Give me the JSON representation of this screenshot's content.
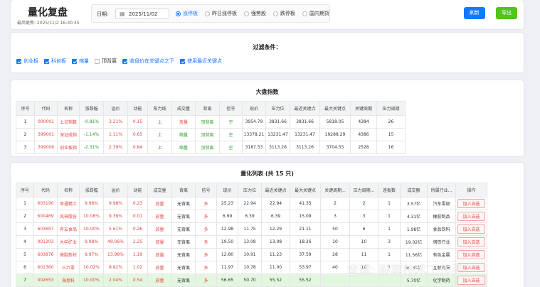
{
  "header": {
    "title": "量化复盘",
    "last_update": "最后更新: 2025/11/2 16:30:35",
    "date_label": "日期:",
    "date_value": "2025/11/02",
    "radio_options": [
      "涨停板",
      "昨日涨停板",
      "强势股",
      "跌停板",
      "国内期货"
    ],
    "selected_option": "涨停板",
    "refresh_label": "刷新",
    "export_label": "导出"
  },
  "filters": {
    "title": "过滤条件：",
    "items": [
      {
        "label": "创业板",
        "checked": true
      },
      {
        "label": "科创板",
        "checked": true
      },
      {
        "label": "缩量",
        "checked": true
      },
      {
        "label": "顶背离",
        "checked": false
      },
      {
        "label": "收盘价在关键点之下",
        "checked": true
      },
      {
        "label": "使用最近关键点",
        "checked": true
      }
    ]
  },
  "market": {
    "title": "大盘指数",
    "columns": [
      "序号",
      "代码",
      "名称",
      "涨跌幅",
      "溢价",
      "动能",
      "阳力线",
      "成交量",
      "背离",
      "信号",
      "现价",
      "压力位",
      "最近关键点",
      "最大关键点",
      "关键周期",
      "压力周期"
    ],
    "rows": [
      [
        "1",
        "000001",
        "上证指数",
        "-0.81%",
        "3.21%",
        "0.15",
        "上",
        "放量",
        "顶背离",
        "空",
        "3954.79",
        "3831.66",
        "3831.66",
        "5818.05",
        "4384",
        "26"
      ],
      [
        "2",
        "399001",
        "深证成指",
        "-1.14%",
        "1.11%",
        "0.65",
        "上",
        "缩量",
        "顶背离",
        "空",
        "13378.21",
        "13231.47",
        "13231.47",
        "19288.29",
        "4386",
        "15"
      ],
      [
        "3",
        "399006",
        "创业板指",
        "-2.31%",
        "2.39%",
        "0.84",
        "上",
        "缩量",
        "顶背离",
        "空",
        "3187.53",
        "3113.26",
        "3113.26",
        "3704.55",
        "2528",
        "16"
      ]
    ]
  },
  "quant": {
    "title": "量化列表 (共 15 只)",
    "columns": [
      "序号",
      "代码",
      "名称",
      "涨跌幅",
      "溢价",
      "动能",
      "成交量",
      "背离",
      "信号",
      "现价",
      "压力位",
      "最近关键点",
      "最大关键点",
      "关键周期...",
      "压力周期...",
      "连板数",
      "成交额",
      "所属行业...",
      "操作"
    ],
    "action_label": "加入自选",
    "rows": [
      [
        "1",
        "603190",
        "亚通精工",
        "9.98%",
        "9.98%",
        "0.23",
        "放量",
        "无背离",
        "多",
        "25.23",
        "22.94",
        "22.94",
        "41.35",
        "2",
        "2",
        "1",
        "3.57亿",
        "汽车零部"
      ],
      [
        "2",
        "600469",
        "风神股份",
        "10.08%",
        "9.39%",
        "0.01",
        "放量",
        "无背离",
        "多",
        "6.99",
        "6.39",
        "6.39",
        "15.09",
        "3",
        "3",
        "1",
        "4.31亿",
        "橡胶制品"
      ],
      [
        "3",
        "603697",
        "有友食品",
        "10.00%",
        "5.61%",
        "0.26",
        "放量",
        "无背离",
        "多",
        "12.98",
        "11.75",
        "12.29",
        "21.11",
        "50",
        "6",
        "1",
        "1.98亿",
        "食品饮料"
      ],
      [
        "4",
        "001203",
        "大中矿业",
        "9.98%",
        "49.06%",
        "2.25",
        "放量",
        "无背离",
        "多",
        "19.50",
        "13.08",
        "13.08",
        "18.26",
        "10",
        "10",
        "3",
        "19.02亿",
        "钢铁行业"
      ],
      [
        "5",
        "603876",
        "鼎胜新材",
        "9.97%",
        "13.98%",
        "1.19",
        "放量",
        "无背离",
        "多",
        "12.80",
        "10.91",
        "11.23",
        "37.59",
        "28",
        "11",
        "1",
        "11.56亿",
        "有色金属"
      ],
      [
        "6",
        "601360",
        "三六零",
        "10.02%",
        "8.82%",
        "1.02",
        "放量",
        "无背离",
        "多",
        "11.97",
        "10.78",
        "11.00",
        "53.97",
        "40",
        "10",
        "1",
        "50.35亿",
        "互联网服"
      ],
      [
        "7",
        "002653",
        "海思科",
        "10.00%",
        "2.04%",
        "0.54",
        "放量",
        "无背离",
        "多",
        "56.65",
        "50.70",
        "55.52",
        "55.52",
        "",
        "",
        "",
        "5.70亿",
        "化学制药"
      ]
    ]
  },
  "watermark": "雪球: 股票技术工作手"
}
